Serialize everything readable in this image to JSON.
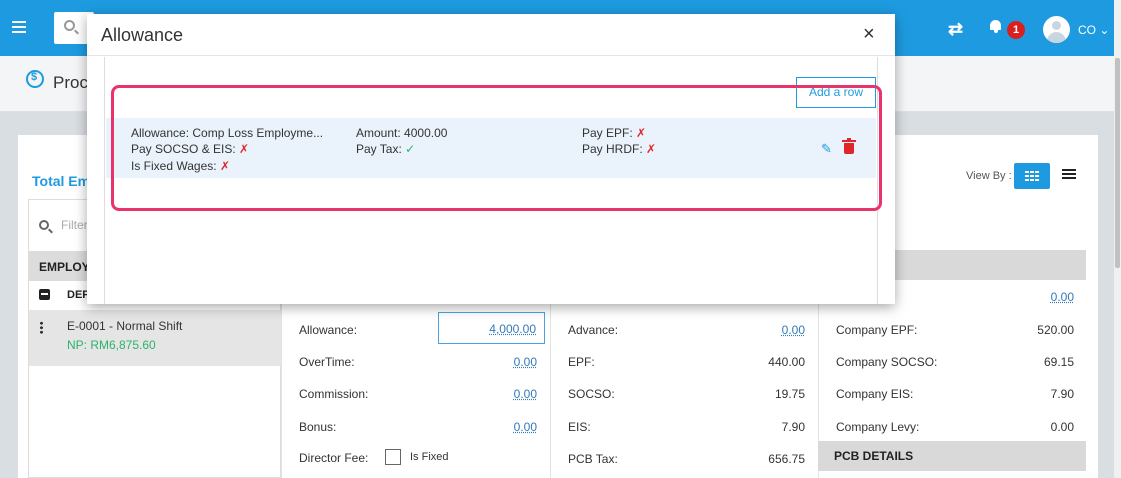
{
  "topbar": {
    "user_initials": "CO",
    "notification_count": "1"
  },
  "page": {
    "title": "Proc"
  },
  "card": {
    "total_label": "Total Em",
    "view_by_label": "View By :",
    "filter_placeholder": "Filter",
    "employee_header": "EMPLOY",
    "dept_label": "DEF",
    "employee": {
      "name": "E-0001 - Normal Shift",
      "net_pay": "NP: RM6,875.60"
    }
  },
  "earnings": [
    {
      "label": "Allowance:",
      "value": "4,000.00"
    },
    {
      "label": "OverTime:",
      "value": "0.00"
    },
    {
      "label": "Commission:",
      "value": "0.00"
    },
    {
      "label": "Bonus:",
      "value": "0.00"
    },
    {
      "label": "Director Fee:",
      "is_fixed_label": "Is Fixed"
    }
  ],
  "deductions": [
    {
      "label": "Advance:",
      "value": "0.00"
    },
    {
      "label": "EPF:",
      "value": "440.00"
    },
    {
      "label": "SOCSO:",
      "value": "19.75"
    },
    {
      "label": "EIS:",
      "value": "7.90"
    },
    {
      "label": "PCB Tax:",
      "value": "656.75"
    }
  ],
  "employer": {
    "top_value": "0.00",
    "rows": [
      {
        "label": "Company EPF:",
        "value": "520.00"
      },
      {
        "label": "Company SOCSO:",
        "value": "69.15"
      },
      {
        "label": "Company EIS:",
        "value": "7.90"
      },
      {
        "label": "Company Levy:",
        "value": "0.00"
      }
    ],
    "pcb_header": "PCB DETAILS"
  },
  "modal": {
    "title": "Allowance",
    "close": "×",
    "add_row_label": "Add a row",
    "item": {
      "allowance_label": "Allowance:",
      "allowance_value": "Comp Loss Employme...",
      "amount_label": "Amount:",
      "amount_value": "4000.00",
      "pay_epf_label": "Pay EPF:",
      "pay_epf_value": "✗",
      "pay_socso_eis_label": "Pay SOCSO & EIS:",
      "pay_socso_eis_value": "✗",
      "pay_tax_label": "Pay Tax:",
      "pay_tax_value": "✓",
      "pay_hrdf_label": "Pay HRDF:",
      "pay_hrdf_value": "✗",
      "is_fixed_wages_label": "Is Fixed Wages:",
      "is_fixed_wages_value": "✗"
    }
  },
  "colors": {
    "primary": "#1e9be0",
    "highlight": "#e8336b",
    "danger": "#e0262a",
    "success": "#2bb36b"
  }
}
